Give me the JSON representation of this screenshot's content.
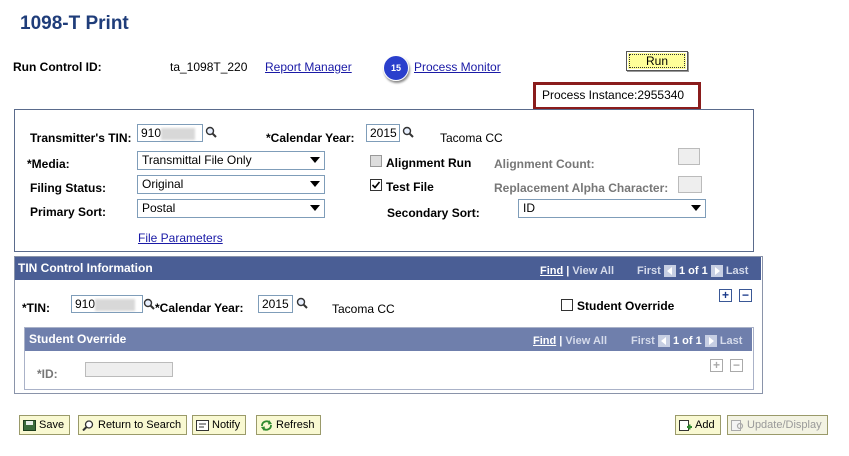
{
  "page": {
    "title": "1098-T Print"
  },
  "header": {
    "run_control_label": "Run Control ID:",
    "run_control_value": "ta_1098T_220",
    "report_manager": "Report Manager",
    "badge": "15",
    "process_monitor": "Process Monitor",
    "run_button": "Run",
    "process_instance": "Process Instance:2955340"
  },
  "form": {
    "transmitter_tin_label": "Transmitter's TIN:",
    "transmitter_tin_value": "910",
    "calendar_year_label": "*Calendar Year:",
    "calendar_year_value": "2015",
    "institution": "Tacoma CC",
    "media_label": "*Media:",
    "media_value": "Transmittal File Only",
    "alignment_run_label": "Alignment Run",
    "alignment_run_checked": false,
    "alignment_count_label": "Alignment Count:",
    "filing_status_label": "Filing Status:",
    "filing_status_value": "Original",
    "test_file_label": "Test File",
    "test_file_checked": true,
    "replacement_alpha_label": "Replacement Alpha Character:",
    "primary_sort_label": "Primary Sort:",
    "primary_sort_value": "Postal",
    "secondary_sort_label": "Secondary Sort:",
    "secondary_sort_value": "ID",
    "file_parameters": "File Parameters"
  },
  "tin_control": {
    "header": "TIN Control Information",
    "find": "Find",
    "sep": "|",
    "view_all": "View All",
    "first": "First",
    "pager": "1 of 1",
    "last": "Last",
    "tin_label": "*TIN:",
    "tin_value": "910",
    "calendar_year_label": "*Calendar Year:",
    "calendar_year_value": "2015",
    "institution": "Tacoma CC",
    "student_override_label": "Student Override",
    "add_row": "+",
    "delete_row": "−"
  },
  "student_override": {
    "header": "Student Override",
    "find": "Find",
    "sep": "|",
    "view_all": "View All",
    "first": "First",
    "pager": "1 of 1",
    "last": "Last",
    "id_label": "*ID:",
    "add_row": "+",
    "delete_row": "−"
  },
  "toolbar": {
    "save": "Save",
    "return_to_search": "Return to Search",
    "notify": "Notify",
    "refresh": "Refresh",
    "add": "Add",
    "update_display": "Update/Display"
  }
}
